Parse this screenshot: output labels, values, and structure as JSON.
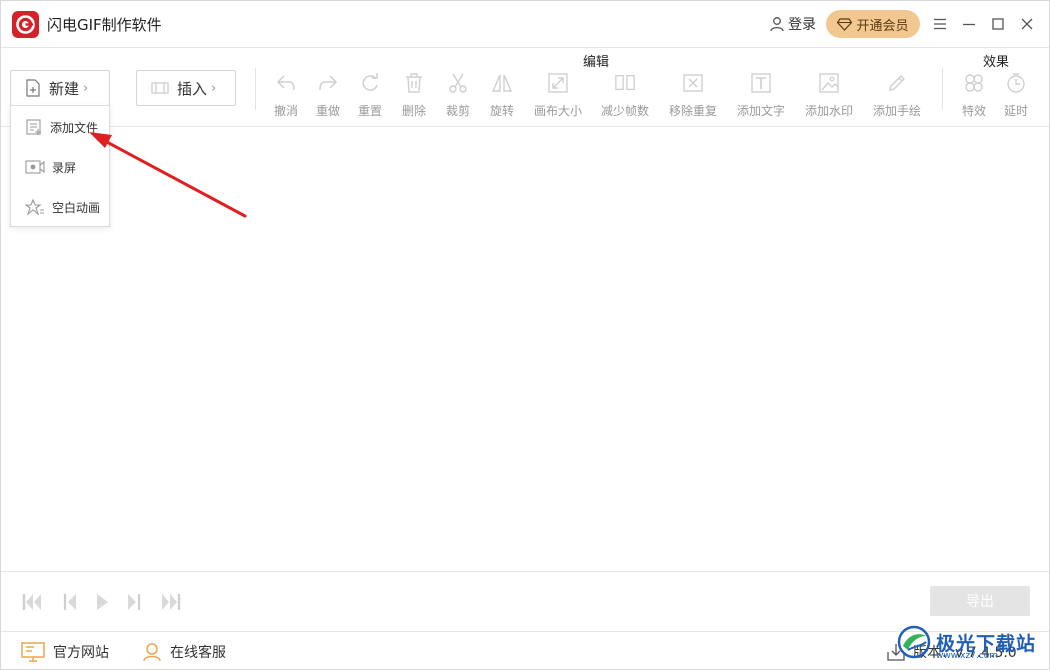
{
  "app": {
    "title": "闪电GIF制作软件"
  },
  "header": {
    "login_label": "登录",
    "vip_label": "开通会员"
  },
  "toolbar": {
    "new_label": "新建",
    "insert_label": "插入",
    "edit_group_label": "编辑",
    "effect_group_label": "效果",
    "tools": {
      "undo": "撤消",
      "redo": "重做",
      "reset": "重置",
      "delete": "删除",
      "crop": "裁剪",
      "rotate": "旋转",
      "canvas_size": "画布大小",
      "reduce_frames": "减少帧数",
      "remove_duplicates": "移除重复",
      "add_text": "添加文字",
      "add_watermark": "添加水印",
      "add_drawing": "添加手绘",
      "effects": "特效",
      "delay": "延时"
    }
  },
  "dropdown": {
    "items": [
      {
        "label": "添加文件",
        "icon": "add-file-icon"
      },
      {
        "label": "录屏",
        "icon": "record-screen-icon"
      },
      {
        "label": "空白动画",
        "icon": "blank-animation-icon"
      }
    ]
  },
  "playback": {
    "export_label": "导出"
  },
  "status": {
    "website_label": "官方网站",
    "support_label": "在线客服",
    "version_label": "版本：v 7.4.5.0"
  },
  "watermark": {
    "text": "极光下载站",
    "sub": "www.xz7.com"
  },
  "colors": {
    "brand_red": "#d6202a",
    "vip_gold": "#f2c890",
    "annotation_red": "#e02020",
    "disabled_grey": "#bfbfbf",
    "status_orange": "#e8a650"
  }
}
